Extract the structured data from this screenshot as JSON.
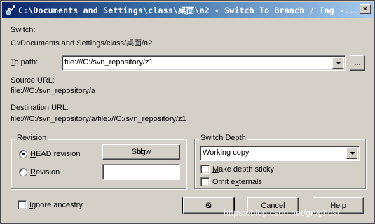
{
  "window": {
    "title": "C:\\Documents and Settings\\class\\桌面\\a2 - Switch To Branch / Tag -...",
    "close_label": "×"
  },
  "switch": {
    "label": "Switch:",
    "path": "C:/Documents and Settings/class/桌面/a2"
  },
  "to_path": {
    "label_prefix": "T",
    "label_rest": "o path:",
    "value": "file:///C:/svn_repository/z1",
    "browse_label": "..."
  },
  "source_url": {
    "label": "Source URL:",
    "value": "file:///C:/svn_repository/a"
  },
  "destination_url": {
    "label": "Destination URL:",
    "value": "file:///C:/svn_repository/a/file:///C:/svn_repository/z1"
  },
  "revision": {
    "legend": "Revision",
    "head_prefix": "H",
    "head_rest": "EAD revision",
    "revision_prefix": "R",
    "revision_rest": "evision",
    "revision_value": "",
    "show_log_prefix": "Show ",
    "show_log_u": "l",
    "show_log_rest": "og",
    "selected": "HEAD revision"
  },
  "switch_depth": {
    "legend": "Switch Depth",
    "selected": "Working copy",
    "make_sticky_prefix": "M",
    "make_sticky_rest": "ake depth sticky",
    "make_sticky_checked": false,
    "omit_prefix": "Omit e",
    "omit_u": "x",
    "omit_rest": "ternals",
    "omit_checked": false
  },
  "ignore_ancestry": {
    "prefix": "I",
    "rest": "gnore ancestry",
    "checked": false
  },
  "buttons": {
    "ok_u": "O",
    "ok_rest": "K",
    "cancel": "Cancel",
    "help": "Help"
  },
  "watermark": "https://blog.csdn.net/gryghost"
}
